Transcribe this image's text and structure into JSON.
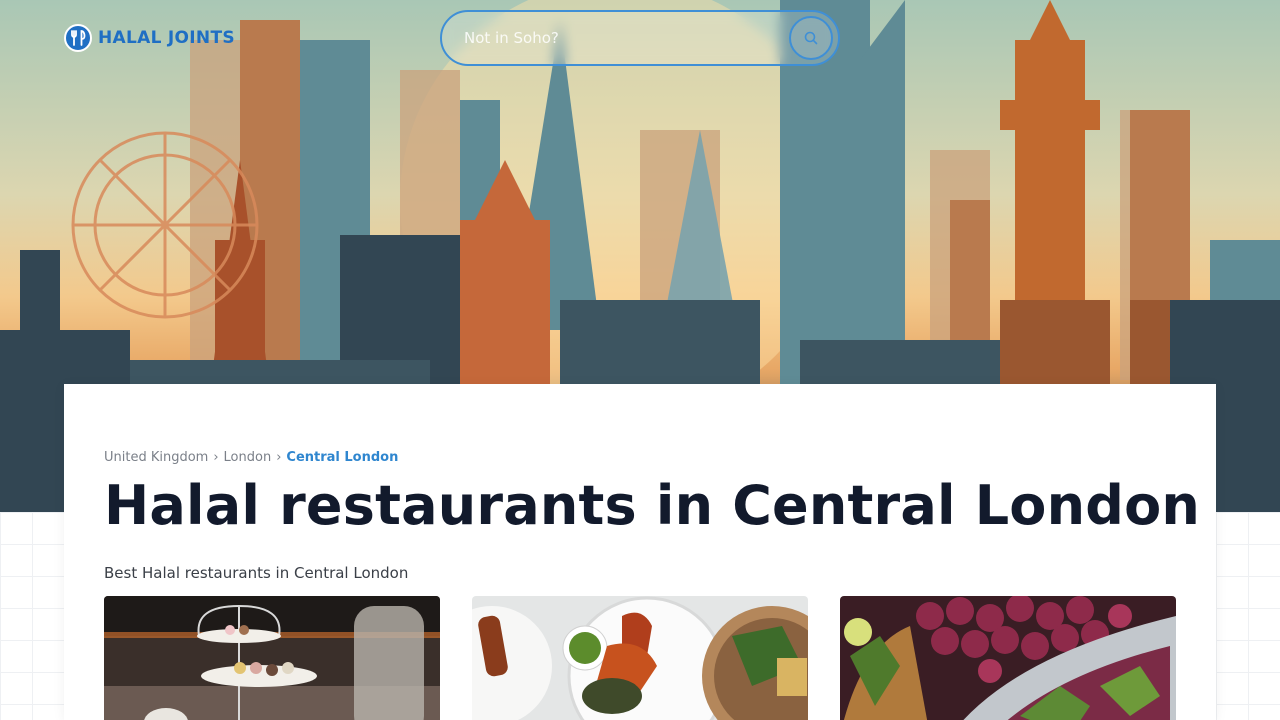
{
  "header": {
    "brand": "HALAL JOINTS",
    "search_placeholder": "Not in Soho?",
    "search_icon": "search-icon",
    "brand_icon": "utensils-icon"
  },
  "breadcrumb": {
    "items": [
      "United Kingdom",
      "London"
    ],
    "separator": "›",
    "current": "Central London"
  },
  "main": {
    "title": "Halal restaurants in Central London",
    "subtitle": "Best Halal restaurants in Central London"
  },
  "colors": {
    "brand": "#1f6fc4",
    "accent": "#2f86cf",
    "title": "#121a2c"
  }
}
